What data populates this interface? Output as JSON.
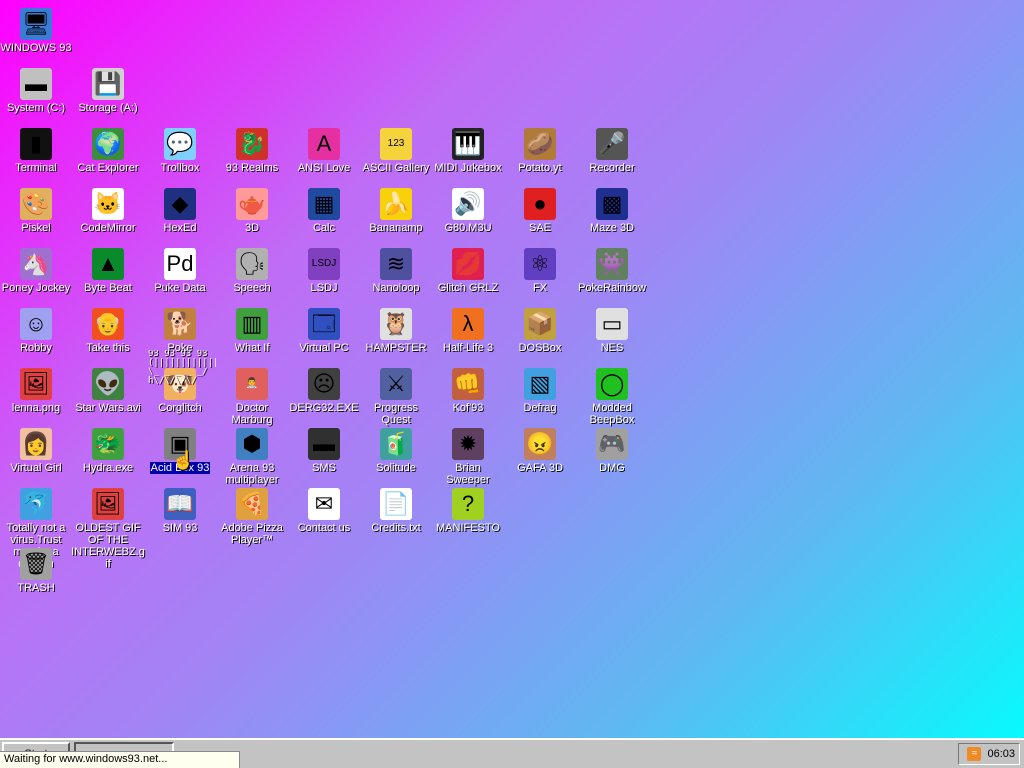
{
  "icons": [
    {
      "label": "WINDOWS 93",
      "glyph": "🖥",
      "bg": "#3a7bd5"
    },
    {
      "label": "System (C:)",
      "glyph": "▬",
      "bg": "#c0c0c0"
    },
    {
      "label": "Storage (A:)",
      "glyph": "💾",
      "bg": "#d0d0d0"
    },
    {
      "label": "Terminal",
      "glyph": "▮",
      "bg": "#111111"
    },
    {
      "label": "Cat Explorer",
      "glyph": "🌍",
      "bg": "#3c8d3c"
    },
    {
      "label": "Trollbox",
      "glyph": "💬",
      "bg": "#7fd0ff"
    },
    {
      "label": "93 Realms",
      "glyph": "🐉",
      "bg": "#d0302a"
    },
    {
      "label": "ANSI Love",
      "glyph": "A",
      "bg": "#e62fa0"
    },
    {
      "label": "ASCII Gallery",
      "glyph": "123",
      "bg": "#f5d33d"
    },
    {
      "label": "MIDI Jukebox",
      "glyph": "🎹",
      "bg": "#222222"
    },
    {
      "label": "Potato.yt",
      "glyph": "🥔",
      "bg": "#b07a3a"
    },
    {
      "label": "Recorder",
      "glyph": "🎤",
      "bg": "#555555"
    },
    {
      "label": "Piskel",
      "glyph": "🎨",
      "bg": "#e0b060"
    },
    {
      "label": "CodeMirror",
      "glyph": "🐱",
      "bg": "#ffffff"
    },
    {
      "label": "HexEd",
      "glyph": "◆",
      "bg": "#203080"
    },
    {
      "label": "3D",
      "glyph": "🫖",
      "bg": "#ff9a9a"
    },
    {
      "label": "Calc",
      "glyph": "▦",
      "bg": "#1f4aa0"
    },
    {
      "label": "Bananamp",
      "glyph": "🍌",
      "bg": "#f7d20a"
    },
    {
      "label": "G80.M3U",
      "glyph": "🔊",
      "bg": "#ffffff"
    },
    {
      "label": "SAE",
      "glyph": "●",
      "bg": "#e02020"
    },
    {
      "label": "Maze 3D",
      "glyph": "▩",
      "bg": "#203090"
    },
    {
      "label": "Poney Jockey",
      "glyph": "🦄",
      "bg": "#a070d0"
    },
    {
      "label": "Byte Beat",
      "glyph": "▲",
      "bg": "#0a8a2a"
    },
    {
      "label": "Puke Data",
      "glyph": "Pd",
      "bg": "#ffffff"
    },
    {
      "label": "Speech",
      "glyph": "🗣",
      "bg": "#b0b0b0"
    },
    {
      "label": "LSDJ",
      "glyph": "LSDJ",
      "bg": "#8040c0"
    },
    {
      "label": "Nanoloop",
      "glyph": "≋",
      "bg": "#5050a0"
    },
    {
      "label": "Glitch GRLZ",
      "glyph": "💋",
      "bg": "#e02050"
    },
    {
      "label": "FX",
      "glyph": "⚛",
      "bg": "#6040c0"
    },
    {
      "label": "PokeRainbow",
      "glyph": "👾",
      "bg": "#608060"
    },
    {
      "label": "Robby",
      "glyph": "☺",
      "bg": "#a0a0f0"
    },
    {
      "label": "Take this",
      "glyph": "👴",
      "bg": "#f05020"
    },
    {
      "label": "Poke",
      "glyph": "🐕",
      "bg": "#c08040"
    },
    {
      "label": "What If",
      "glyph": "▥",
      "bg": "#40a040"
    },
    {
      "label": "Virtual PC",
      "glyph": "🗔",
      "bg": "#3050c0"
    },
    {
      "label": "HAMPSTER",
      "glyph": "🦉",
      "bg": "#e0e0e0"
    },
    {
      "label": "Half-Life 3",
      "glyph": "λ",
      "bg": "#f07020"
    },
    {
      "label": "DOSBox",
      "glyph": "📦",
      "bg": "#c0a040"
    },
    {
      "label": "NES",
      "glyph": "▭",
      "bg": "#e0e0e0"
    },
    {
      "label": "lenna.png",
      "glyph": "🖼",
      "bg": "#e04040"
    },
    {
      "label": "Star Wars.avi",
      "glyph": "👽",
      "bg": "#408040"
    },
    {
      "label": "Corglitch",
      "glyph": "🐶",
      "bg": "#f0b060"
    },
    {
      "label": "Doctor Marburg",
      "glyph": "👨‍⚕",
      "bg": "#e06060"
    },
    {
      "label": "DERG32.EXE",
      "glyph": "☹",
      "bg": "#404040"
    },
    {
      "label": "Progress Quest",
      "glyph": "⚔",
      "bg": "#5060a0"
    },
    {
      "label": "Kof'93",
      "glyph": "👊",
      "bg": "#c06040"
    },
    {
      "label": "Defrag",
      "glyph": "▧",
      "bg": "#40a0e0"
    },
    {
      "label": "Modded BeepBox",
      "glyph": "◯",
      "bg": "#20c020"
    },
    {
      "label": "Virtual Girl",
      "glyph": "👩",
      "bg": "#f0c0a0"
    },
    {
      "label": "Hydra.exe",
      "glyph": "🐲",
      "bg": "#40a040"
    },
    {
      "label": "Acid Box 93",
      "glyph": "▣",
      "bg": "#808080"
    },
    {
      "label": "Arena 93 multiplayer",
      "glyph": "⬢",
      "bg": "#4080c0"
    },
    {
      "label": "SMS",
      "glyph": "▬",
      "bg": "#303030"
    },
    {
      "label": "Solitude",
      "glyph": "🧃",
      "bg": "#40a0a0"
    },
    {
      "label": "Brian Sweeper",
      "glyph": "✹",
      "bg": "#604060"
    },
    {
      "label": "GAFA 3D",
      "glyph": "😠",
      "bg": "#c08060"
    },
    {
      "label": "DMG",
      "glyph": "🎮",
      "bg": "#a0a0a0"
    },
    {
      "label": "Totally not a virus.Trust me...im a dolphin",
      "glyph": "🐬",
      "bg": "#40a0e0"
    },
    {
      "label": "OLDEST GIF OF THE INTERWEBZ.gif",
      "glyph": "🖼",
      "bg": "#e04040"
    },
    {
      "label": "SIM 93",
      "glyph": "📖",
      "bg": "#4060c0"
    },
    {
      "label": "Adobe Pizza Player™",
      "glyph": "🍕",
      "bg": "#e0a040"
    },
    {
      "label": "Contact us",
      "glyph": "✉",
      "bg": "#ffffff"
    },
    {
      "label": "Credits.txt",
      "glyph": "📄",
      "bg": "#ffffff"
    },
    {
      "label": "MANIFESTO",
      "glyph": "?",
      "bg": "#a0d020"
    },
    {
      "label": "TRASH",
      "glyph": "🗑",
      "bg": "#a0a0a0"
    }
  ],
  "glitch_text": "93 93 93 93\n(|||||||||||||)\n\\_ _ _ _ _/\nh\\/\\/\\/\\/",
  "taskbar": {
    "start_label": "Start",
    "task_label": "",
    "clock": "06:03",
    "rss_glyph": "≈"
  },
  "status": {
    "text": "Waiting for www.windows93.net..."
  },
  "cursor_glyph": "☝"
}
